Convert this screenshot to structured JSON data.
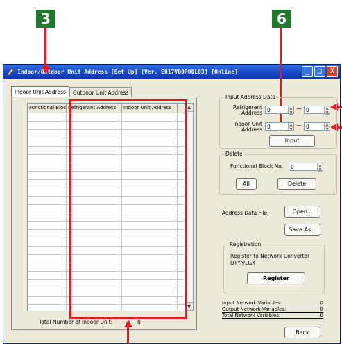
{
  "callouts": {
    "badge_3": "3",
    "badge_6": "6"
  },
  "window": {
    "title": "Indoor/Outdoor Unit Address   [Set Up] [Ver. E017V00P00L03] [Online]",
    "minimize": "_",
    "maximize": "□",
    "close": "X"
  },
  "tabs": {
    "indoor": "Indoor Unit Address",
    "outdoor": "Outdoor Unit Address"
  },
  "grid": {
    "headers": [
      "Functional Block",
      "Refrigerant Address",
      "Indoor Unit Address"
    ],
    "scroll_up": "▲",
    "scroll_down": "▼"
  },
  "total": {
    "label": "Total Number of Indoor Unit:",
    "value": "0"
  },
  "input_address": {
    "title": "Input Address Data",
    "refrigerant_label": "Refrigerant Address",
    "indoor_label": "Indoor Unit Address",
    "ref_from": "0",
    "ref_to": "0",
    "iu_from": "0",
    "iu_to": "0",
    "dash": "—",
    "input_button": "Input"
  },
  "delete": {
    "title": "Delete",
    "fb_label": "Functional Block No.",
    "fb_value": "0",
    "all_button": "All",
    "delete_button": "Delete"
  },
  "address_file": {
    "label": "Address Data File;",
    "open_button": "Open...",
    "save_button": "Save As..."
  },
  "registration": {
    "title": "Registration",
    "text_line1": "Register to Network Convertor",
    "text_line2": "UTY-VLGX",
    "register_button": "Register"
  },
  "network_vars": [
    {
      "label": "Input Network Variables:",
      "value": "0"
    },
    {
      "label": "Output Network Variables:",
      "value": "0"
    },
    {
      "label": "Total Network Variables:",
      "value": "0"
    }
  ],
  "back_button": "Back",
  "colors": {
    "callout_red": "#e01b24",
    "badge_green": "#1f7a2e",
    "titlebar_blue": "#1646c6"
  }
}
